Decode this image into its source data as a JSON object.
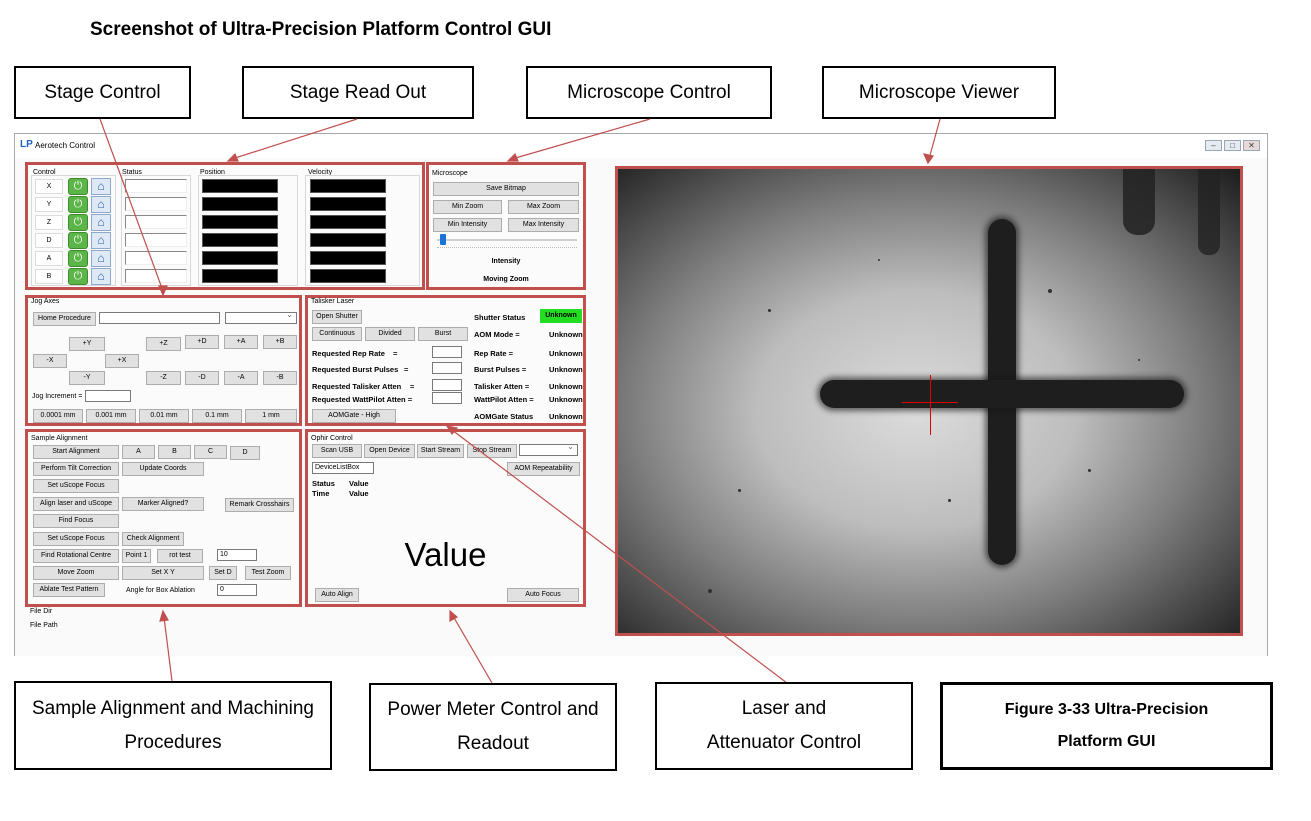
{
  "doc_title": "Screenshot of Ultra-Precision Platform Control GUI",
  "callouts": {
    "stage_control": "Stage Control",
    "stage_readout": "Stage Read Out",
    "microscope_control": "Microscope Control",
    "microscope_viewer": "Microscope Viewer",
    "sample_alignment": "Sample Alignment and Machining Procedures",
    "power_meter": "Power Meter Control and Readout",
    "laser_attenuator": "Laser and Attenuator Control",
    "figure_caption": "Figure 3-33 Ultra-Precision Platform GUI"
  },
  "window": {
    "title": "Aerotech Control",
    "app_icon": "LP",
    "buttons": {
      "minimize": "–",
      "maximize": "□",
      "close": "✕"
    }
  },
  "stage": {
    "headers": {
      "control": "Control",
      "status": "Status",
      "position": "Position",
      "velocity": "Velocity"
    },
    "axes": [
      "X",
      "Y",
      "Z",
      "D",
      "A",
      "B"
    ],
    "power_glyph": "⏻",
    "home_glyph": "⌂"
  },
  "microscope": {
    "label": "Microscope",
    "save_bitmap": "Save Bitmap",
    "min_zoom": "Min Zoom",
    "max_zoom": "Max Zoom",
    "min_intensity": "Min Intensity",
    "max_intensity": "Max Intensity",
    "intensity_label": "Intensity",
    "moving_zoom": "Moving Zoom",
    "intensity_level": 0.02
  },
  "jog": {
    "label": "Jog Axes",
    "home_procedure": "Home Procedure",
    "buttons": {
      "py": "+Y",
      "pz": "+Z",
      "pd": "+D",
      "pa": "+A",
      "pb": "+B",
      "mx": "-X",
      "px": "+X",
      "my": "-Y",
      "mz": "-Z",
      "md": "-D",
      "ma": "-A",
      "mb": "-B"
    },
    "increment_label": "Jog Increment =",
    "increments": [
      "0.0001 mm",
      "0.001 mm",
      "0.01 mm",
      "0.1 mm",
      "1 mm"
    ]
  },
  "talisker": {
    "label": "Talisker Laser",
    "open_shutter": "Open Shutter",
    "continuous": "Continuous",
    "divided": "Divided",
    "burst": "Burst",
    "req_rep_rate": "Requested Rep Rate",
    "req_burst": "Requested Burst Pulses",
    "req_talisker_atten": "Requested Talisker Atten",
    "req_wattpilot_atten": "Requested WattPilot Atten =",
    "eq": "=",
    "aomgate_button": "AOMGate - High",
    "shutter_status": "Shutter Status",
    "shutter_value": "Unknown",
    "aom_mode": "AOM Mode =",
    "rep_rate": "Rep Rate =",
    "burst_pulses": "Burst Pulses =",
    "talisker_atten": "Talisker Atten =",
    "wattpilot_atten": "WattPilot Atten =",
    "aomgate_status": "AOMGate Status",
    "unknown": "Unknown",
    "shutter_color": "#22dd22"
  },
  "alignment": {
    "label": "Sample Alignment",
    "start_alignment": "Start Alignment",
    "a": "A",
    "b": "B",
    "c": "C",
    "d": "D",
    "tilt_correction": "Perform Tilt Correction",
    "update_coords": "Update Coords",
    "set_uscope_focus": "Set uScope Focus",
    "align_laser": "Align laser and uScope",
    "marker_aligned": "Marker Aligned?",
    "remark_crosshairs": "Remark Crosshairs",
    "find_focus": "Find Focus",
    "set_uscope_focus2": "Set uScope Focus",
    "check_alignment": "Check Alignment",
    "find_rot_centre": "Find Rotational Centre",
    "point1": "Point 1",
    "rot_test": "rot test",
    "rot_value": "10",
    "move_zoom": "Move Zoom",
    "set_xy": "Set X Y",
    "set_d": "Set D",
    "test_zoom": "Test Zoom",
    "ablate_test": "Ablate Test Pattern",
    "angle_label": "Angle for Box Ablation",
    "angle_value": "0"
  },
  "files": {
    "dir": "File Dir",
    "path": "File Path"
  },
  "ophir": {
    "label": "Ophir Control",
    "scan_usb": "Scan USB",
    "open_device": "Open Device",
    "start_stream": "Start Stream",
    "stop_stream": "Stop Stream",
    "device_list": "DeviceListBox",
    "aom_repeat": "AOM Repeatability",
    "status_label": "Status",
    "status_value": "Value",
    "time_label": "Time",
    "time_value": "Value",
    "big_value": "Value",
    "auto_align": "Auto Align",
    "auto_focus": "Auto Focus"
  },
  "colors": {
    "annotation_red": "#c0504d",
    "crosshair": "#e00000"
  },
  "icons": {
    "power": "power-icon",
    "home": "home-icon"
  }
}
